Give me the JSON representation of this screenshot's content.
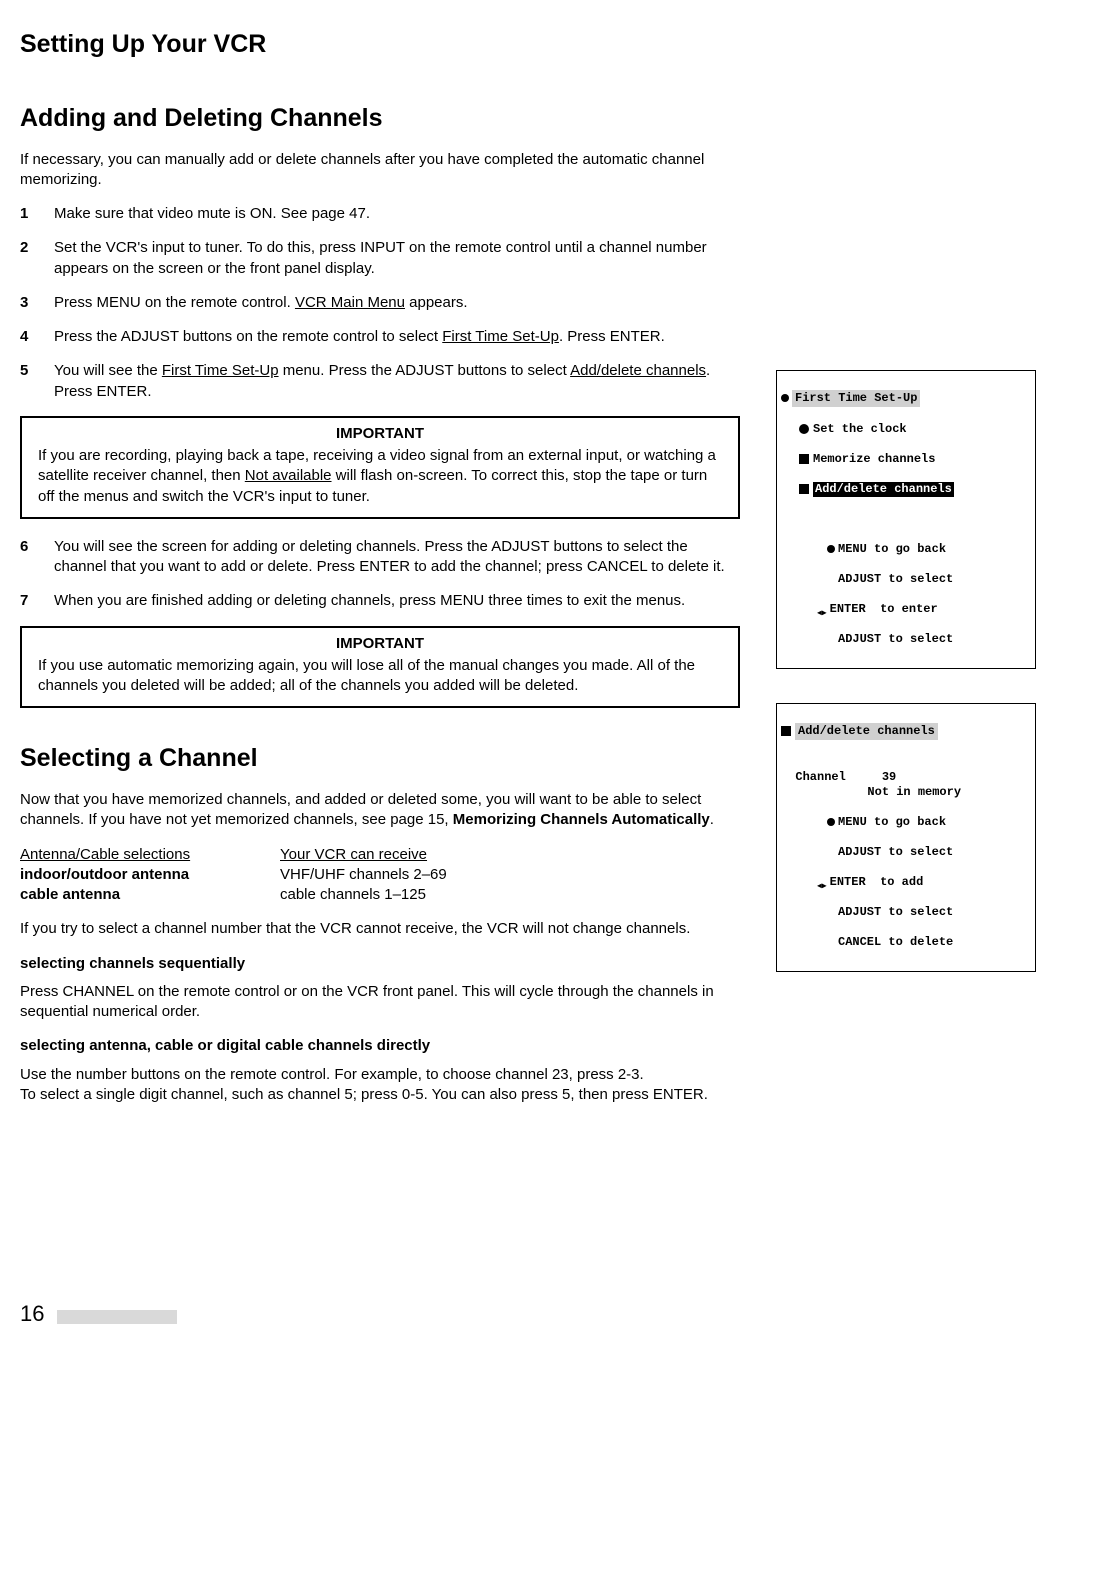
{
  "page_title": "Setting Up Your VCR",
  "h1": "Adding and Deleting Channels",
  "intro": "If necessary, you can manually add or delete channels after you have completed the automatic channel memorizing.",
  "steps": {
    "s1": "Make sure that video mute is ON.  See page 47.",
    "s2": "Set the VCR's input to tuner.  To do this, press INPUT on the remote control until a channel number appears on the screen or the front panel display.",
    "s3a": "Press MENU on the remote control.  ",
    "s3b": "VCR Main Menu",
    "s3c": " appears.",
    "s4a": "Press the ADJUST buttons on the remote control to select ",
    "s4b": "First Time Set-Up",
    "s4c": ".  Press ENTER.",
    "s5a": "You will see the ",
    "s5b": "First Time Set-Up",
    "s5c": " menu.  Press the ADJUST buttons to select ",
    "s5d": "Add/delete channels",
    "s5e": ".  Press ENTER.",
    "s6": "You will see the screen for adding or deleting channels.  Press the ADJUST buttons to select the channel that you want to add or delete.  Press ENTER to add the channel; press CANCEL to delete it.",
    "s7": "When you are finished adding or deleting channels, press MENU three times to exit the menus."
  },
  "imp1": {
    "title": "IMPORTANT",
    "t1": "If you are recording, playing back a tape, receiving a video signal from an external input, or watching a satellite receiver channel, then ",
    "t2": "Not available",
    "t3": " will flash on-screen.  To correct this, stop the tape or turn off the menus and switch the VCR's input to tuner."
  },
  "imp2": {
    "title": "IMPORTANT",
    "body": "If you use automatic memorizing again, you will lose all of the manual changes you made.  All of the channels you deleted will be added; all of the channels you added will be deleted."
  },
  "h2": "Selecting a Channel",
  "sel_intro_a": "Now that you have memorized channels, and added or deleted some, you will want to be able to select channels.  If you have not yet memorized channels, see page 15, ",
  "sel_intro_b": "Memorizing Channels Automatically",
  "sel_intro_c": ".",
  "table": {
    "h1": "Antenna/Cable selections",
    "h2": "Your VCR can receive",
    "r1c1": "indoor/outdoor antenna",
    "r1c2": "VHF/UHF channels 2–69",
    "r2c1": "cable antenna",
    "r2c2": "cable channels 1–125"
  },
  "sel_p2": "If you try to select a channel number that the VCR cannot receive, the VCR will not change channels.",
  "sub1": "selecting channels sequentially",
  "sel_p3": "Press CHANNEL on the remote control or on the VCR front panel.  This will cycle through the channels in sequential numerical order.",
  "sub2": "selecting antenna, cable or digital cable channels directly",
  "sel_p4a": "Use the number buttons on the remote control.  For example, to choose channel 23, press 2-3.",
  "sel_p4b": "To select a single digit channel, such as channel 5; press 0-5.  You can also press 5, then press ENTER.",
  "osd1": {
    "title": "First Time Set-Up",
    "l1": "Set the clock",
    "l2": "Memorize channels",
    "l3": "Add/delete channels",
    "h1": "MENU to go back",
    "h2": "ADJUST to select",
    "h3": "ENTER  to enter",
    "h4": "ADJUST to select"
  },
  "osd2": {
    "title": "Add/delete channels",
    "l1": "Channel     39",
    "l2": "Not in memory",
    "h1": "MENU to go back",
    "h2": "ADJUST to select",
    "h3": "ENTER  to add",
    "h4": "ADJUST to select",
    "h5": "CANCEL to delete"
  },
  "page_number": "16"
}
